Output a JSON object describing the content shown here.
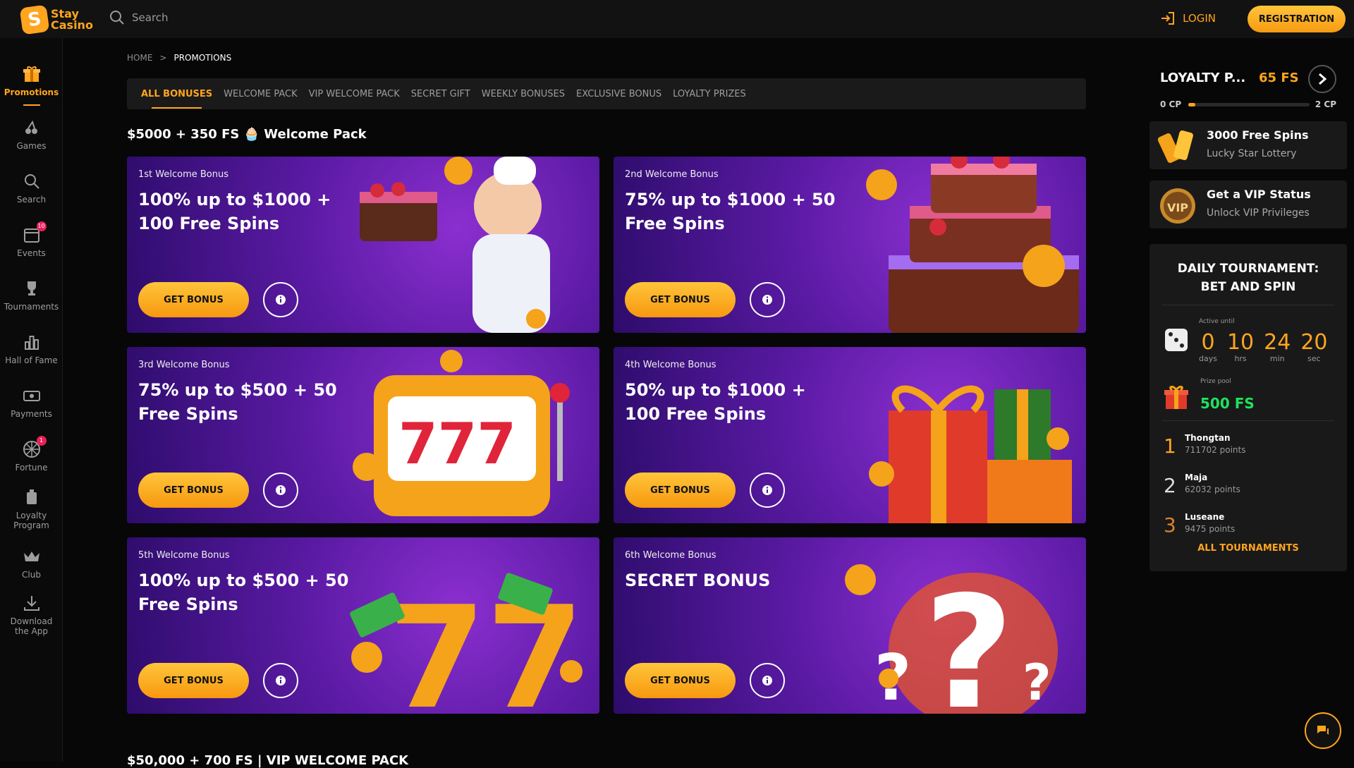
{
  "header": {
    "logo_line1": "Stay",
    "logo_line2": "Casino",
    "logo_mark": "S",
    "search_placeholder": "Search",
    "login_label": "LOGIN",
    "registration_label": "REGISTRATION"
  },
  "sidebar": {
    "items": [
      {
        "label": "Promotions",
        "icon": "gift-icon"
      },
      {
        "label": "Games",
        "icon": "cherries-icon"
      },
      {
        "label": "Search",
        "icon": "search-icon"
      },
      {
        "label": "Events",
        "icon": "calendar-icon",
        "badge": "10"
      },
      {
        "label": "Tournaments",
        "icon": "trophy-icon"
      },
      {
        "label": "Hall of Fame",
        "icon": "chart-icon"
      },
      {
        "label": "Payments",
        "icon": "wallet-icon"
      },
      {
        "label": "Fortune",
        "icon": "wheel-icon",
        "badge": "1"
      },
      {
        "label": "Loyalty Program",
        "icon": "loyalty-icon"
      },
      {
        "label": "Club",
        "icon": "crown-icon"
      },
      {
        "label": "Download the App",
        "icon": "download-icon"
      }
    ]
  },
  "breadcrumb": {
    "home": "HOME",
    "separator": ">",
    "current": "PROMOTIONS"
  },
  "tabs": [
    "ALL BONUSES",
    "WELCOME PACK",
    "VIP WELCOME PACK",
    "SECRET GIFT",
    "WEEKLY BONUSES",
    "EXCLUSIVE BONUS",
    "LOYALTY PRIZES"
  ],
  "section": {
    "title": "$5000 + 350 FS 🧁 Welcome Pack",
    "next_title": "$50,000 + 700 FS | VIP WELCOME PACK"
  },
  "cards": [
    {
      "sub": "1st Welcome Bonus",
      "title": "100% up to $1000 + 100 Free Spins",
      "button": "GET BONUS"
    },
    {
      "sub": "2nd Welcome Bonus",
      "title": "75% up to $1000 + 50 Free Spins",
      "button": "GET BONUS"
    },
    {
      "sub": "3rd Welcome Bonus",
      "title": "75% up to $500 + 50 Free Spins",
      "button": "GET BONUS"
    },
    {
      "sub": "4th Welcome Bonus",
      "title": "50% up to $1000 + 100 Free Spins",
      "button": "GET BONUS"
    },
    {
      "sub": "5th Welcome Bonus",
      "title": "100% up to $500 + 50 Free Spins",
      "button": "GET BONUS"
    },
    {
      "sub": "6th Welcome Bonus",
      "title": "SECRET BONUS",
      "button": "GET BONUS"
    }
  ],
  "loyalty": {
    "title": "LOYALTY P...",
    "fs": "65 FS",
    "cp_start": "0 CP",
    "cp_end": "2 CP",
    "progress": 0.06
  },
  "promos": [
    {
      "title": "3000 Free Spins",
      "subtitle": "Lucky Star Lottery"
    },
    {
      "title": "Get a VIP Status",
      "subtitle": "Unlock VIP Privileges",
      "icon_text": "VIP"
    }
  ],
  "tournament": {
    "title": "DAILY TOURNAMENT: BET AND SPIN",
    "active_until": "Active until",
    "timer": [
      {
        "value": "0",
        "unit": "days"
      },
      {
        "value": "10",
        "unit": "hrs"
      },
      {
        "value": "24",
        "unit": "min"
      },
      {
        "value": "20",
        "unit": "sec"
      }
    ],
    "prize_label": "Prize pool",
    "prize_value": "500 FS",
    "leaders": [
      {
        "rank": "1",
        "name": "Thongtan",
        "points": "711702 points"
      },
      {
        "rank": "2",
        "name": "Maja",
        "points": "62032 points"
      },
      {
        "rank": "3",
        "name": "Luseane",
        "points": "9475 points"
      }
    ],
    "all_label": "ALL TOURNAMENTS"
  },
  "colors": {
    "accent": "#ffa51f",
    "prize": "#1ee35c",
    "badge": "#e8205a"
  }
}
